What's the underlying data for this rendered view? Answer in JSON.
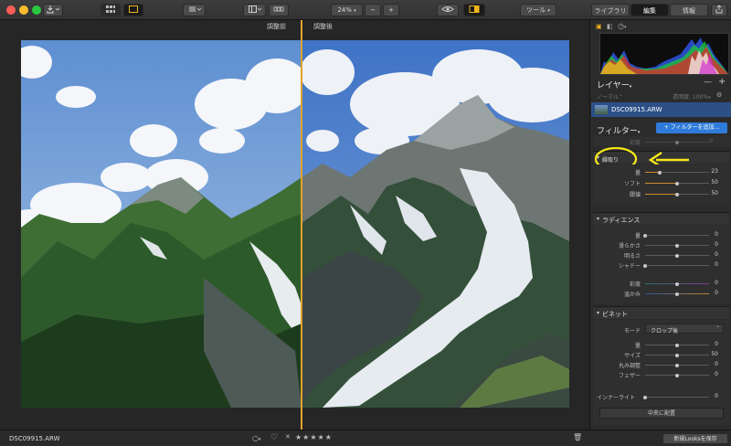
{
  "toolbar": {
    "zoom": "24%",
    "zoom_minus": "−",
    "zoom_plus": "+",
    "tools_label": "ツール",
    "tabs": [
      {
        "label": "ライブラリ",
        "active": false
      },
      {
        "label": "編集",
        "active": true
      },
      {
        "label": "情報",
        "active": false
      }
    ]
  },
  "compare": {
    "before_label": "調整前",
    "after_label": "調整後"
  },
  "bottom": {
    "filename": "DSC09915.ARW",
    "rating_stars": "★★★★★",
    "save_looks": "新規Looksを保存"
  },
  "layers": {
    "title": "レイヤー",
    "blend_mode": "ノーマル",
    "opacity_label": "透明度: 100%",
    "layer_name": "DSC09915.ARW"
  },
  "filters": {
    "title": "フィルター",
    "add_button": "+ フィルターを追加...",
    "faded_label": "彩度",
    "faded_value": "0"
  },
  "edge": {
    "title": "縁取り",
    "sliders": [
      {
        "label": "量",
        "value": "23",
        "fraction": 0.23
      },
      {
        "label": "ソフト",
        "value": "50",
        "fraction": 0.5
      },
      {
        "label": "閾値",
        "value": "50",
        "fraction": 0.5
      }
    ]
  },
  "gradient": {
    "title": "ラディエンス",
    "sliders": [
      {
        "label": "量",
        "value": "0",
        "fraction": 0.0
      },
      {
        "label": "滑らかさ",
        "value": "0",
        "fraction": 0.5
      },
      {
        "label": "明るさ",
        "value": "0",
        "fraction": 0.5
      },
      {
        "label": "シャドー",
        "value": "0",
        "fraction": 0.0
      }
    ],
    "color_sliders": [
      {
        "label": "彩度",
        "value": "0",
        "fraction": 0.5
      },
      {
        "label": "温かみ",
        "value": "0",
        "fraction": 0.5
      }
    ]
  },
  "vignette": {
    "title": "ビネット",
    "mode_label": "モード",
    "mode_value": "クロップ後",
    "sliders": [
      {
        "label": "量",
        "value": "0",
        "fraction": 0.5
      },
      {
        "label": "サイズ",
        "value": "50",
        "fraction": 0.5
      },
      {
        "label": "丸み調整",
        "value": "0",
        "fraction": 0.5
      },
      {
        "label": "フェザー",
        "value": "0",
        "fraction": 0.5
      }
    ],
    "inner_light_label": "インナーライト",
    "inner_light_value": "0",
    "inner_light_fraction": 0.0,
    "center_button": "中央に配置"
  },
  "colors": {
    "accent": "#f2b51b",
    "blue": "#2f7bdb",
    "divider": "#e0a32a",
    "annotation": "#f5e71a"
  }
}
